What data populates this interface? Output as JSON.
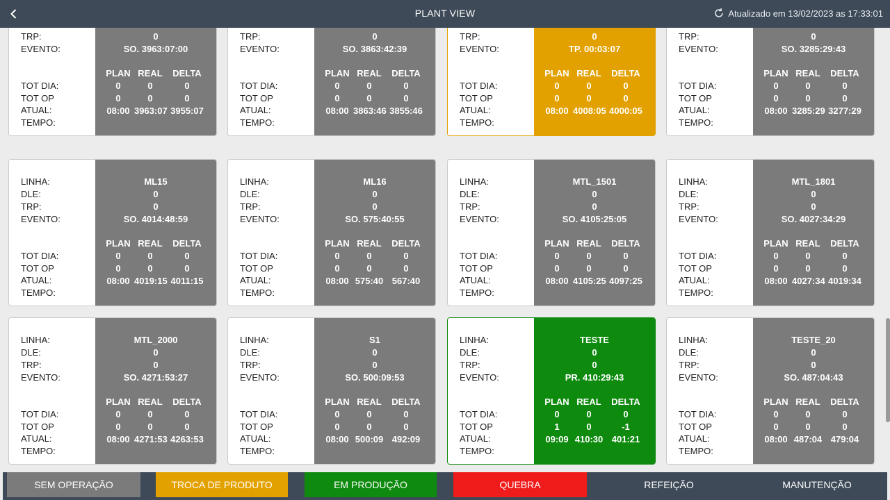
{
  "header": {
    "title": "PLANT VIEW",
    "updated": "Atualizado em 13/02/2023 as 17:33:01"
  },
  "labels": {
    "linha": "LINHA:",
    "dle": "DLE:",
    "trp": "TRP:",
    "evento": "EVENTO:",
    "tot_dia": "TOT DIA:",
    "tot_op": "TOT OP",
    "atual": "ATUAL:",
    "tempo": "TEMPO:",
    "plan": "PLAN",
    "real": "REAL",
    "delta": "DELTA"
  },
  "cards": [
    {
      "status": "gray",
      "linha": "",
      "dle": "0",
      "trp": "0",
      "evento": "SO. 3963:07:00",
      "tot_dia": [
        "0",
        "0",
        "0"
      ],
      "tot_op": [
        "0",
        "0",
        "0"
      ],
      "atual": [
        "08:00",
        "3963:07",
        "3955:07"
      ]
    },
    {
      "status": "gray",
      "linha": "",
      "dle": "0",
      "trp": "0",
      "evento": "SO. 3863:42:39",
      "tot_dia": [
        "0",
        "0",
        "0"
      ],
      "tot_op": [
        "0",
        "0",
        "0"
      ],
      "atual": [
        "08:00",
        "3863:46",
        "3855:46"
      ]
    },
    {
      "status": "amber",
      "linha": "",
      "dle": "0",
      "trp": "0",
      "evento": "TP. 00:03:07",
      "tot_dia": [
        "0",
        "0",
        "0"
      ],
      "tot_op": [
        "0",
        "0",
        "0"
      ],
      "atual": [
        "08:00",
        "4008:05",
        "4000:05"
      ]
    },
    {
      "status": "gray",
      "linha": "",
      "dle": "0",
      "trp": "0",
      "evento": "SO. 3285:29:43",
      "tot_dia": [
        "0",
        "0",
        "0"
      ],
      "tot_op": [
        "0",
        "0",
        "0"
      ],
      "atual": [
        "08:00",
        "3285:29",
        "3277:29"
      ]
    },
    {
      "status": "gray",
      "linha": "ML15",
      "dle": "0",
      "trp": "0",
      "evento": "SO. 4014:48:59",
      "tot_dia": [
        "0",
        "0",
        "0"
      ],
      "tot_op": [
        "0",
        "0",
        "0"
      ],
      "atual": [
        "08:00",
        "4019:15",
        "4011:15"
      ]
    },
    {
      "status": "gray",
      "linha": "ML16",
      "dle": "0",
      "trp": "0",
      "evento": "SO. 575:40:55",
      "tot_dia": [
        "0",
        "0",
        "0"
      ],
      "tot_op": [
        "0",
        "0",
        "0"
      ],
      "atual": [
        "08:00",
        "575:40",
        "567:40"
      ]
    },
    {
      "status": "gray",
      "linha": "MTL_1501",
      "dle": "0",
      "trp": "0",
      "evento": "SO. 4105:25:05",
      "tot_dia": [
        "0",
        "0",
        "0"
      ],
      "tot_op": [
        "0",
        "0",
        "0"
      ],
      "atual": [
        "08:00",
        "4105:25",
        "4097:25"
      ]
    },
    {
      "status": "gray",
      "linha": "MTL_1801",
      "dle": "0",
      "trp": "0",
      "evento": "SO. 4027:34:29",
      "tot_dia": [
        "0",
        "0",
        "0"
      ],
      "tot_op": [
        "0",
        "0",
        "0"
      ],
      "atual": [
        "08:00",
        "4027:34",
        "4019:34"
      ]
    },
    {
      "status": "gray",
      "linha": "MTL_2000",
      "dle": "0",
      "trp": "0",
      "evento": "SO. 4271:53:27",
      "tot_dia": [
        "0",
        "0",
        "0"
      ],
      "tot_op": [
        "0",
        "0",
        "0"
      ],
      "atual": [
        "08:00",
        "4271:53",
        "4263:53"
      ]
    },
    {
      "status": "gray",
      "linha": "S1",
      "dle": "0",
      "trp": "0",
      "evento": "SO. 500:09:53",
      "tot_dia": [
        "0",
        "0",
        "0"
      ],
      "tot_op": [
        "0",
        "0",
        "0"
      ],
      "atual": [
        "08:00",
        "500:09",
        "492:09"
      ]
    },
    {
      "status": "green",
      "linha": "TESTE",
      "dle": "0",
      "trp": "0",
      "evento": "PR. 410:29:43",
      "tot_dia": [
        "0",
        "0",
        "0"
      ],
      "tot_op": [
        "1",
        "0",
        "-1"
      ],
      "atual": [
        "09:09",
        "410:30",
        "401:21"
      ]
    },
    {
      "status": "gray",
      "linha": "TESTE_20",
      "dle": "0",
      "trp": "0",
      "evento": "SO. 487:04:43",
      "tot_dia": [
        "0",
        "0",
        "0"
      ],
      "tot_op": [
        "0",
        "0",
        "0"
      ],
      "atual": [
        "08:00",
        "487:04",
        "479:04"
      ]
    }
  ],
  "legend": [
    {
      "label": "SEM OPERAÇÃO",
      "color": "#7b7b7b"
    },
    {
      "label": "TROCA DE PRODUTO",
      "color": "#e3a100"
    },
    {
      "label": "EM PRODUÇÃO",
      "color": "#0e8a0e"
    },
    {
      "label": "QUEBRA",
      "color": "#f01c1c"
    },
    {
      "label": "REFEIÇÃO",
      "color": "#3e4a57"
    },
    {
      "label": "MANUTENÇÃO",
      "color": "#3e4a57"
    }
  ],
  "colors": {
    "header_bg": "#3e4a57",
    "gray": "#7b7b7b",
    "amber": "#e3a100",
    "green": "#0e8a0e",
    "red": "#f01c1c"
  }
}
